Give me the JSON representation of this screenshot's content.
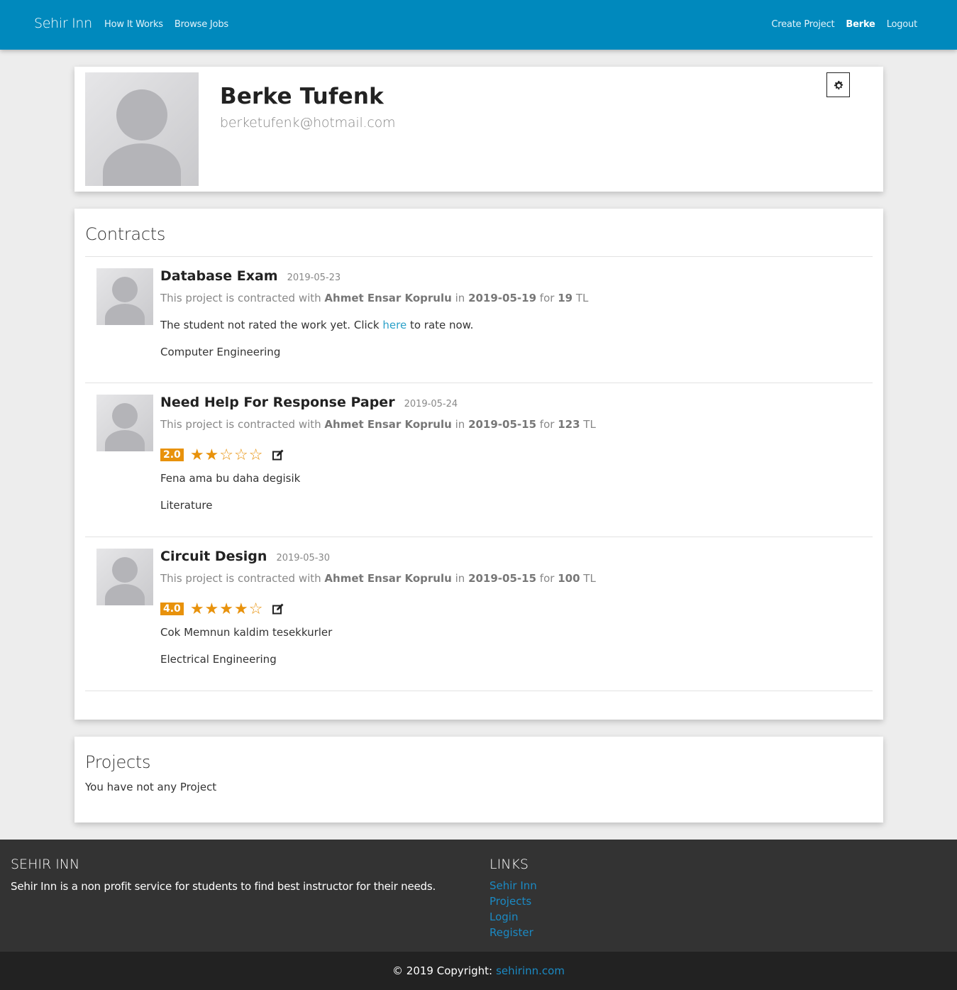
{
  "nav": {
    "brand": "Sehir Inn",
    "left_links": [
      "How It Works",
      "Browse Jobs"
    ],
    "right_links": [
      "Create Project",
      "Berke",
      "Logout"
    ]
  },
  "profile": {
    "name": "Berke Tufenk",
    "email": "berketufenk@hotmail.com",
    "settings_icon": "gear-icon"
  },
  "contracts": {
    "title": "Contracts",
    "meta_prefix": "This project is contracted with",
    "meta_in": "in",
    "meta_for": "for",
    "currency": "TL",
    "items": [
      {
        "title": "Database Exam",
        "date": "2019-05-23",
        "contractor": "Ahmet Ensar Koprulu",
        "contract_date": "2019-05-19",
        "price": "19",
        "not_rated_prefix": "The student not rated the work yet. Click",
        "not_rated_link": "here",
        "not_rated_suffix": "to rate now.",
        "category": "Computer Engineering"
      },
      {
        "title": "Need Help For Response Paper",
        "date": "2019-05-24",
        "contractor": "Ahmet Ensar Koprulu",
        "contract_date": "2019-05-15",
        "price": "123",
        "rating": "2.0",
        "stars": "★★☆☆☆",
        "comment": "Fena ama bu daha degisik",
        "category": "Literature"
      },
      {
        "title": "Circuit Design",
        "date": "2019-05-30",
        "contractor": "Ahmet Ensar Koprulu",
        "contract_date": "2019-05-15",
        "price": "100",
        "rating": "4.0",
        "stars": "★★★★☆",
        "comment": "Cok Memnun kaldim tesekkurler",
        "category": "Electrical Engineering"
      }
    ]
  },
  "projects": {
    "title": "Projects",
    "empty_text": "You have not any Project"
  },
  "footer": {
    "about_title": "SEHIR INN",
    "about_text": "Sehir Inn is a non profit service for students to find best instructor for their needs.",
    "links_title": "LINKS",
    "links": [
      "Sehir Inn",
      "Projects",
      "Login",
      "Register"
    ],
    "copyright_prefix": "© 2019 Copyright:",
    "copyright_link": "sehirinn.com"
  },
  "colors": {
    "navbar": "#0089bd",
    "accent": "#e8920c",
    "link": "#2aa0c8",
    "footer": "#333333",
    "copyright_bar": "#222222"
  }
}
